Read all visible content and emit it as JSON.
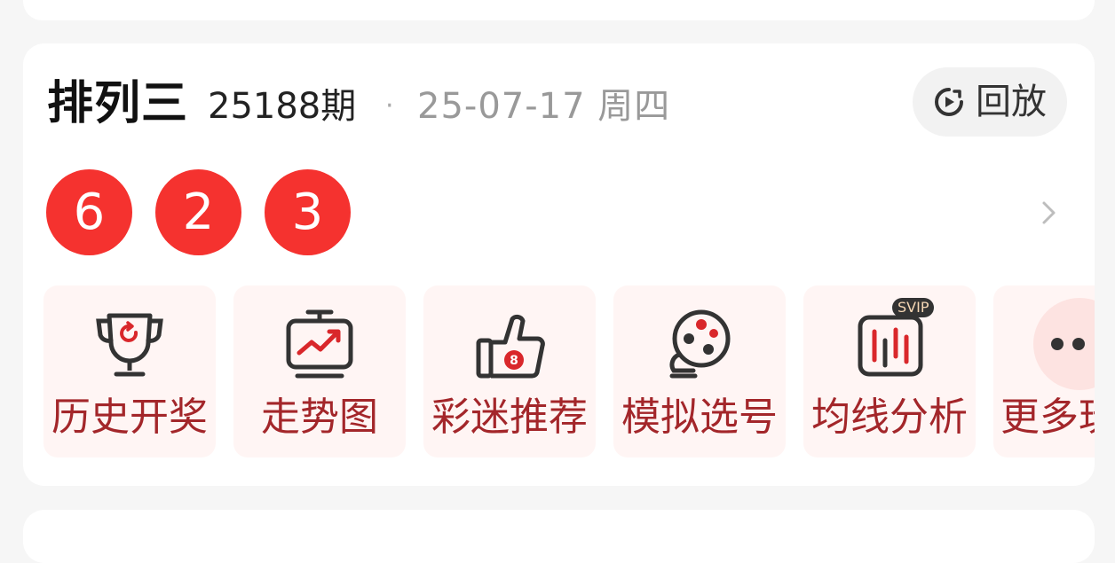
{
  "lottery": {
    "name": "排列三",
    "issue": "25188期",
    "separator": "·",
    "date": "25-07-17 周四"
  },
  "replay": {
    "label": "回放",
    "icon": "replay-icon"
  },
  "numbers": [
    "6",
    "2",
    "3"
  ],
  "colors": {
    "ball": "#f5322f",
    "tile_bg": "#fff5f4",
    "tile_text": "#a3262a",
    "svip_bg": "#333333",
    "svip_text": "#f5d7b5"
  },
  "tools": [
    {
      "label": "历史开奖",
      "icon": "trophy-cup-icon"
    },
    {
      "label": "走势图",
      "icon": "trend-chart-icon"
    },
    {
      "label": "彩迷推荐",
      "icon": "thumbs-up-icon",
      "icon_text": "8"
    },
    {
      "label": "模拟选号",
      "icon": "lottery-ball-machine-icon"
    },
    {
      "label": "均线分析",
      "icon": "candlestick-chart-icon",
      "badge": "SVIP"
    },
    {
      "label": "更多玩法",
      "icon": "more-icon"
    }
  ],
  "detail_chevron": "chevron-right-icon"
}
